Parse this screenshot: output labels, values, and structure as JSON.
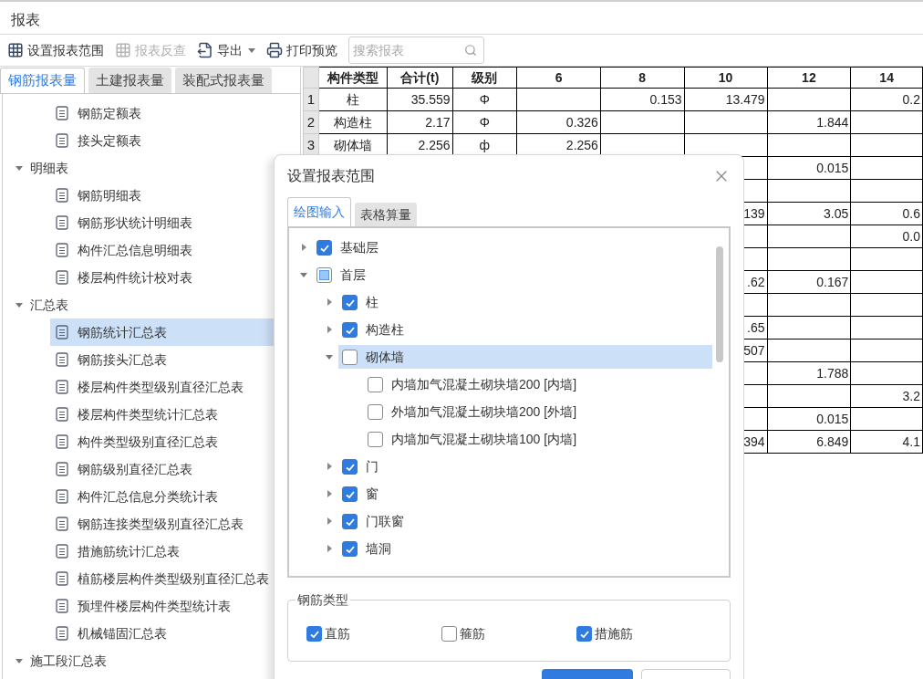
{
  "window": {
    "title": "报表"
  },
  "toolbar": {
    "items": [
      {
        "label": "设置报表范围",
        "kind": "grid",
        "disabled": false,
        "dropdown": false
      },
      {
        "label": "报表反查",
        "kind": "grid",
        "disabled": true,
        "dropdown": false
      },
      {
        "label": "导出",
        "kind": "export",
        "disabled": false,
        "dropdown": true
      },
      {
        "label": "打印预览",
        "kind": "print",
        "disabled": false,
        "dropdown": false
      }
    ],
    "search": {
      "placeholder": "搜索报表"
    }
  },
  "left_tabs": [
    {
      "label": "钢筋报表量",
      "selected": true
    },
    {
      "label": "土建报表量",
      "selected": false
    },
    {
      "label": "装配式报表量",
      "selected": false
    }
  ],
  "report_tree": [
    {
      "children": [
        {
          "label": "钢筋定额表",
          "selected": false
        },
        {
          "label": "接头定额表",
          "selected": false
        }
      ]
    },
    {
      "label": "明细表",
      "expanded": true,
      "children": [
        {
          "label": "钢筋明细表",
          "selected": false
        },
        {
          "label": "钢筋形状统计明细表",
          "selected": false
        },
        {
          "label": "构件汇总信息明细表",
          "selected": false
        },
        {
          "label": "楼层构件统计校对表",
          "selected": false
        }
      ]
    },
    {
      "label": "汇总表",
      "expanded": true,
      "children": [
        {
          "label": "钢筋统计汇总表",
          "selected": true
        },
        {
          "label": "钢筋接头汇总表",
          "selected": false
        },
        {
          "label": "楼层构件类型级别直径汇总表",
          "selected": false
        },
        {
          "label": "楼层构件类型统计汇总表",
          "selected": false
        },
        {
          "label": "构件类型级别直径汇总表",
          "selected": false
        },
        {
          "label": "钢筋级别直径汇总表",
          "selected": false
        },
        {
          "label": "构件汇总信息分类统计表",
          "selected": false
        },
        {
          "label": "钢筋连接类型级别直径汇总表",
          "selected": false
        },
        {
          "label": "措施筋统计汇总表",
          "selected": false
        },
        {
          "label": "植筋楼层构件类型级别直径汇总表",
          "selected": false
        },
        {
          "label": "预埋件楼层构件类型统计表",
          "selected": false
        },
        {
          "label": "机械锚固汇总表",
          "selected": false
        }
      ]
    },
    {
      "label": "施工段汇总表",
      "expanded": true
    }
  ],
  "table": {
    "columns": [
      "构件类型",
      "合计(t)",
      "级别",
      "6",
      "8",
      "10",
      "12",
      "14"
    ],
    "rows": [
      {
        "number": "1",
        "cells": [
          "柱",
          "35.559",
          "Φ",
          null,
          "0.153",
          "13.479",
          null,
          "0.2"
        ]
      },
      {
        "number": "2",
        "cells": [
          "构造柱",
          "2.17",
          "Φ",
          "0.326",
          null,
          null,
          "1.844",
          null
        ]
      },
      {
        "number": "3",
        "cells": [
          "砌体墙",
          "2.256",
          "ф",
          "2.256",
          null,
          null,
          null,
          null
        ]
      },
      {
        "cells": [
          null,
          null,
          null,
          null,
          null,
          null,
          "0.015",
          null
        ]
      },
      {
        "cells": [
          null,
          null,
          null,
          null,
          null,
          null,
          null,
          null
        ]
      },
      {
        "cells": [
          null,
          null,
          null,
          null,
          null,
          "139",
          "3.05",
          "0.6"
        ]
      },
      {
        "cells": [
          null,
          null,
          null,
          null,
          null,
          null,
          null,
          "0.0"
        ]
      },
      {
        "cells": [
          null,
          null,
          null,
          null,
          null,
          null,
          null,
          null
        ]
      },
      {
        "cells": [
          null,
          null,
          null,
          null,
          null,
          ".62",
          "0.167",
          null
        ]
      },
      {
        "cells": [
          null,
          null,
          null,
          null,
          null,
          null,
          null,
          null
        ]
      },
      {
        "cells": [
          null,
          null,
          null,
          null,
          null,
          ".65",
          null,
          null
        ]
      },
      {
        "cells": [
          null,
          null,
          null,
          null,
          null,
          "507",
          null,
          null
        ]
      },
      {
        "cells": [
          null,
          null,
          null,
          null,
          null,
          null,
          "1.788",
          null
        ]
      },
      {
        "cells": [
          null,
          null,
          null,
          null,
          null,
          null,
          null,
          "3.2"
        ]
      },
      {
        "cells": [
          null,
          null,
          null,
          null,
          null,
          null,
          "0.015",
          null
        ]
      },
      {
        "cells": [
          null,
          null,
          null,
          null,
          null,
          "394",
          "6.849",
          "4.1"
        ]
      }
    ]
  },
  "dialog": {
    "title": "设置报表范围",
    "tabs": [
      {
        "label": "绘图输入",
        "selected": true
      },
      {
        "label": "表格算量",
        "selected": false
      }
    ],
    "tree": [
      {
        "label": "基础层",
        "checked": true,
        "indeterminate": false,
        "expanded": false,
        "selected": false
      },
      {
        "label": "首层",
        "checked": false,
        "indeterminate": true,
        "expanded": true,
        "selected": false,
        "children": [
          {
            "label": "柱",
            "checked": true,
            "indeterminate": false,
            "expanded": false,
            "selected": false
          },
          {
            "label": "构造柱",
            "checked": true,
            "indeterminate": false,
            "expanded": false,
            "selected": false
          },
          {
            "label": "砌体墙",
            "checked": false,
            "indeterminate": false,
            "expanded": true,
            "selected": true,
            "children": [
              {
                "label": "内墙加气混凝土砌块墙200 [内墙]",
                "checked": false,
                "indeterminate": false,
                "selected": false
              },
              {
                "label": "外墙加气混凝土砌块墙200 [外墙]",
                "checked": false,
                "indeterminate": false,
                "selected": false
              },
              {
                "label": "内墙加气混凝土砌块墙100 [内墙]",
                "checked": false,
                "indeterminate": false,
                "selected": false
              }
            ]
          },
          {
            "label": "门",
            "checked": true,
            "indeterminate": false,
            "expanded": false,
            "selected": false
          },
          {
            "label": "窗",
            "checked": true,
            "indeterminate": false,
            "expanded": false,
            "selected": false
          },
          {
            "label": "门联窗",
            "checked": true,
            "indeterminate": false,
            "expanded": false,
            "selected": false
          },
          {
            "label": "墙洞",
            "checked": true,
            "indeterminate": false,
            "expanded": false,
            "selected": false
          }
        ]
      }
    ],
    "rebar_types": {
      "title": "钢筋类型",
      "options": [
        {
          "label": "直筋",
          "checked": true
        },
        {
          "label": "箍筋",
          "checked": false
        },
        {
          "label": "措施筋",
          "checked": true
        }
      ]
    }
  }
}
